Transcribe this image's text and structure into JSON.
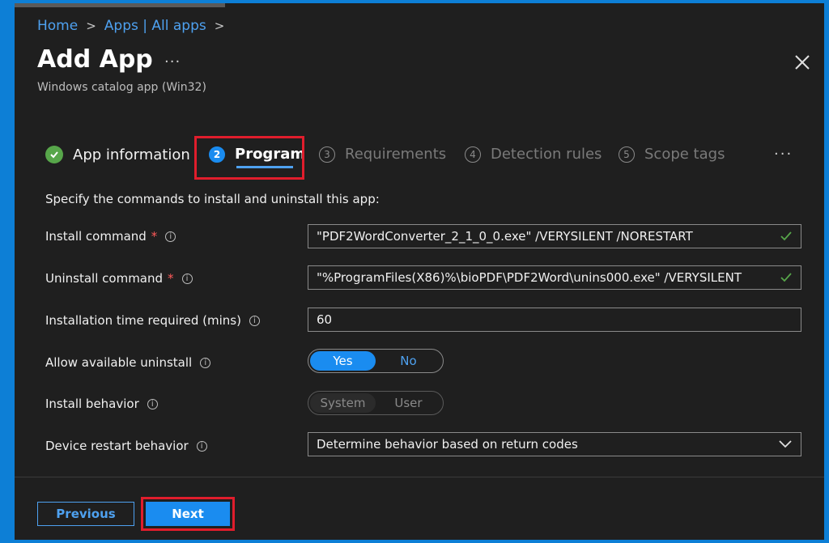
{
  "breadcrumb": {
    "home": "Home",
    "apps": "Apps | All apps"
  },
  "header": {
    "title": "Add App",
    "more": "···",
    "subtitle": "Windows catalog app (Win32)"
  },
  "wizard": {
    "steps": [
      {
        "num": "",
        "label": "App information",
        "state": "done"
      },
      {
        "num": "2",
        "label": "Program",
        "state": "active"
      },
      {
        "num": "3",
        "label": "Requirements",
        "state": "upcoming"
      },
      {
        "num": "4",
        "label": "Detection rules",
        "state": "upcoming"
      },
      {
        "num": "5",
        "label": "Scope tags",
        "state": "upcoming"
      }
    ],
    "more": "···"
  },
  "form": {
    "intro": "Specify the commands to install and uninstall this app:",
    "install_command": {
      "label": "Install command",
      "required": "*",
      "value": "\"PDF2WordConverter_2_1_0_0.exe\" /VERYSILENT /NORESTART"
    },
    "uninstall_command": {
      "label": "Uninstall command",
      "required": "*",
      "value": "\"%ProgramFiles(X86)%\\bioPDF\\PDF2Word\\unins000.exe\" /VERYSILENT"
    },
    "install_time": {
      "label": "Installation time required (mins)",
      "value": "60"
    },
    "allow_uninstall": {
      "label": "Allow available uninstall",
      "on": "Yes",
      "off": "No",
      "selected": "Yes"
    },
    "install_behavior": {
      "label": "Install behavior",
      "on": "System",
      "off": "User",
      "selected": "System"
    },
    "restart_behavior": {
      "label": "Device restart behavior",
      "value": "Determine behavior based on return codes"
    }
  },
  "footer": {
    "previous": "Previous",
    "next": "Next"
  },
  "colors": {
    "accent": "#1a8cf0",
    "highlight": "#e01d2c",
    "success": "#57a64a"
  }
}
